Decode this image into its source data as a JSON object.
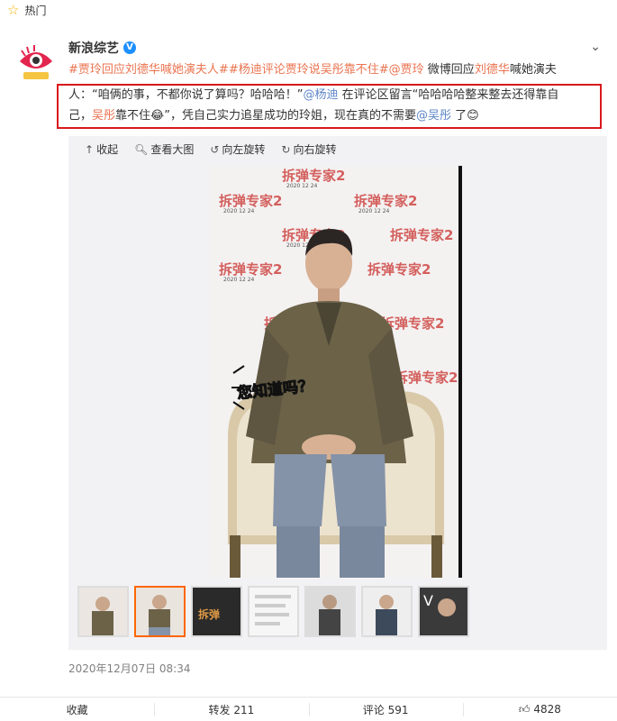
{
  "section": {
    "label": "热门",
    "icon": "star-icon"
  },
  "post": {
    "author": "新浪综艺",
    "verified_badge": "V",
    "avatar_caption": "新浪综艺",
    "line1": {
      "tag1": "#贾玲回应",
      "tag1_name": "刘德华",
      "tag1_rest": "喊她演夫人#",
      "tag2_a": "#杨迪评论贾玲说",
      "tag2_name": "吴彤",
      "tag2_b": "靠不住#",
      "mention": "@贾玲",
      "text1": " 微博回应",
      "name1": "刘德华",
      "text2": "喊她演夫"
    },
    "line2": {
      "text1": "人：“咱俩的事，不都你说了算吗？哈哈哈！”",
      "mention": "@杨迪",
      "text2": " 在评论区留言“哈哈哈哈整来整去还得靠自"
    },
    "line3": {
      "text1": "己，",
      "name": "吴彤",
      "text2": "靠不住",
      "emoji1": "😂",
      "text3": "”，凭自己实力追星成功的玲姐，现在真的不需要",
      "mention": "@吴彤",
      "text4": " 了",
      "emoji2": "😊"
    },
    "timestamp": "2020年12月07日 08:34"
  },
  "media_toolbar": {
    "collapse": "收起",
    "view_large": "查看大图",
    "rotate_left": "向左旋转",
    "rotate_right": "向右旋转"
  },
  "image": {
    "backdrop_text": "拆弹专家2",
    "backdrop_date": "2020 12 24",
    "caption": "您知道吗？"
  },
  "thumbnails_count": 7,
  "actions": {
    "favorite": "收藏",
    "repost": "转发 211",
    "comment": "评论 591",
    "like": "4828"
  },
  "colors": {
    "accent": "#eb7350",
    "link_blue": "#5d85c8",
    "highlight_border": "#d9191c",
    "active_thumb": "#ff6600",
    "verified": "#1e90ff"
  }
}
